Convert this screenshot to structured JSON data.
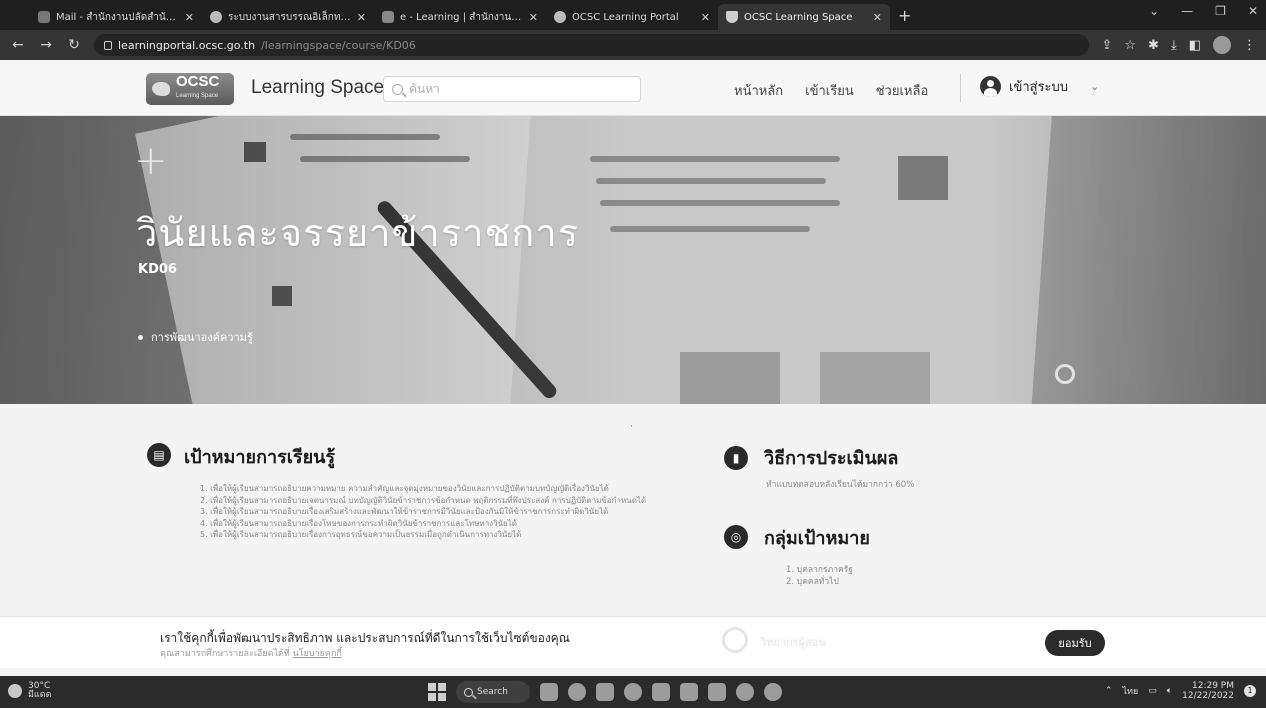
{
  "browser": {
    "tabs": [
      {
        "title": "Mail - สำนักงานปลัดสำนักงานศาล",
        "favicon": "outlook-icon"
      },
      {
        "title": "ระบบงานสารบรรณอิเล็กทรอนิกส์",
        "favicon": "globe-icon"
      },
      {
        "title": "e - Learning | สำนักงาน ก.พ. (OCS",
        "favicon": "grid-icon"
      },
      {
        "title": "OCSC Learning Portal",
        "favicon": "ocsc-icon"
      },
      {
        "title": "OCSC Learning Space",
        "favicon": "flask-icon",
        "active": true
      }
    ],
    "new_tab": "+",
    "url_host": "learningportal.ocsc.go.th",
    "url_path": "/learningspace/course/KD06"
  },
  "header": {
    "logo_text": "OCSC",
    "logo_sub": "Learning Space",
    "brand": "Learning Space",
    "search_placeholder": "ค้นหา",
    "nav": [
      "หน้าหลัก",
      "เข้าเรียน",
      "ช่วยเหลือ"
    ],
    "login": "เข้าสู่ระบบ"
  },
  "hero": {
    "title": "วินัยและจรรยาข้าราชการ",
    "code": "KD06",
    "category": "การพัฒนาองค์ความรู้"
  },
  "objectives": {
    "title": "เป้าหมายการเรียนรู้",
    "items": [
      "1. เพื่อให้ผู้เรียนสามารถอธิบายความหมาย ความสำคัญและจุดมุ่งหมายของวินัยและการปฏิบัติตามบทบัญญัติเรื่องวินัยได้",
      "2. เพื่อให้ผู้เรียนสามารถอธิบายเจตนารมณ์ บทบัญญัติวินัยข้าราชการข้อกำหนด พฤติกรรมที่พึงประสงค์ การปฏิบัติตามข้อกำหนดได้",
      "3. เพื่อให้ผู้เรียนสามารถอธิบายเรื่องเสริมสร้างและพัฒนาให้ข้าราชการมีวินัยและป้องกันมิให้ข้าราชการกระทำผิดวินัยได้",
      "4. เพื่อให้ผู้เรียนสามารถอธิบายเรื่องโทษของการกระทำผิดวินัยข้าราชการและโทษทางวินัยได้",
      "5. เพื่อให้ผู้เรียนสามารถอธิบายเรื่องการอุทธรณ์ขอความเป็นธรรมเมื่อถูกดำเนินการทางวินัยได้"
    ]
  },
  "evaluation": {
    "title": "วิธีการประเมินผล",
    "text": "ทำแบบทดสอบหลังเรียนได้มากกว่า 60%"
  },
  "audience": {
    "title": "กลุ่มเป้าหมาย",
    "items": [
      "1. บุคลากรภาครัฐ",
      "2. บุคคลทั่วไป"
    ]
  },
  "cookie": {
    "text": "เราใช้คุกกี้เพื่อพัฒนาประสิทธิภาพ และประสบการณ์ที่ดีในการใช้เว็บไซต์ของคุณ",
    "sub": "คุณสามารถศึกษารายละเอียดได้ที่",
    "link": "นโยบายคุกกี้",
    "accept": "ยอมรับ",
    "behind": "วิทยากรผู้สอน"
  },
  "taskbar": {
    "temp": "30°C",
    "weather": "มีแดด",
    "search": "Search",
    "lang": "ไทย",
    "time": "12:29 PM",
    "date": "12/22/2022"
  }
}
